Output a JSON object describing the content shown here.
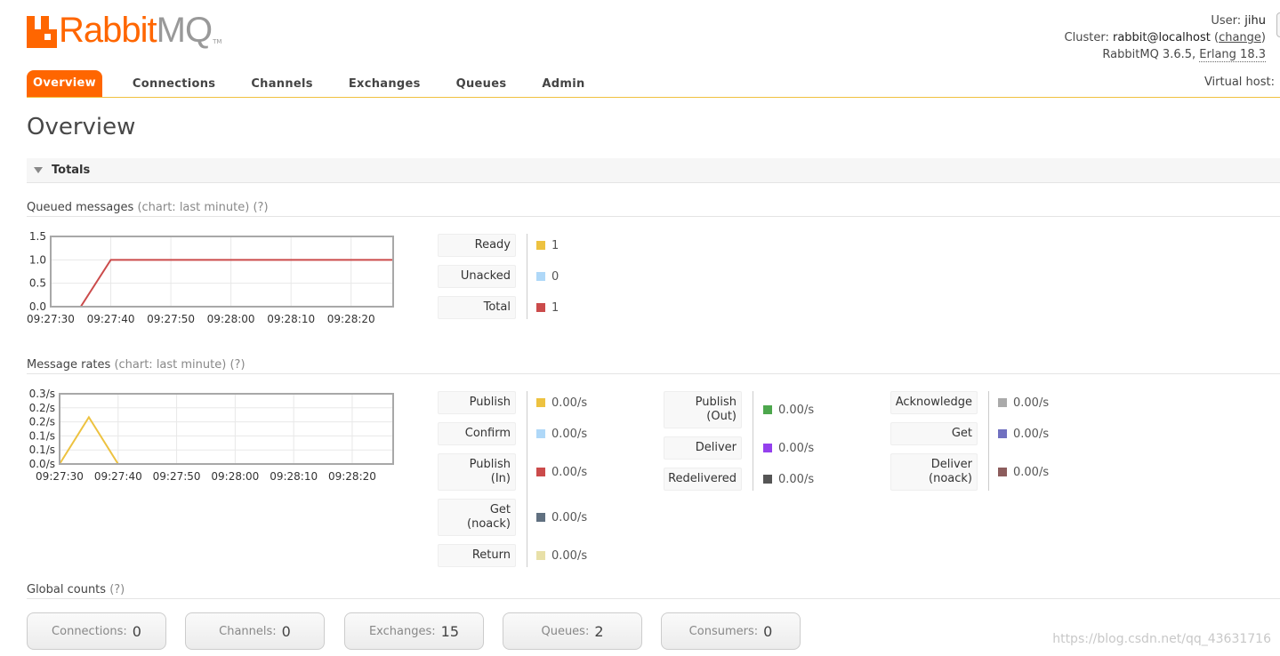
{
  "brand": {
    "word": "Rabbit",
    "word_mq": "MQ",
    "tm": "TM"
  },
  "login": {
    "user_label": "User:",
    "user": "jihu",
    "cluster_label": "Cluster:",
    "cluster": "rabbit@localhost",
    "change_label": "change",
    "version": "RabbitMQ 3.6.5,",
    "erlang": "Erlang 18.3"
  },
  "tabs": [
    "Overview",
    "Connections",
    "Channels",
    "Exchanges",
    "Queues",
    "Admin"
  ],
  "virtual_host_label": "Virtual host:",
  "page_title": "Overview",
  "totals_label": "Totals",
  "queued": {
    "title": "Queued messages",
    "sub": "(chart: last minute)",
    "help": "(?)",
    "legend": [
      {
        "label": "Ready",
        "value": "1",
        "color": "#edc240"
      },
      {
        "label": "Unacked",
        "value": "0",
        "color": "#afd8f8"
      },
      {
        "label": "Total",
        "value": "1",
        "color": "#cb4b4b"
      }
    ]
  },
  "rates": {
    "title": "Message rates",
    "sub": "(chart: last minute)",
    "help": "(?)",
    "col1": [
      {
        "label": "Publish",
        "value": "0.00/s",
        "color": "#edc240"
      },
      {
        "label": "Confirm",
        "value": "0.00/s",
        "color": "#afd8f8"
      },
      {
        "label": "Publish\n(In)",
        "value": "0.00/s",
        "color": "#cb4b4b"
      },
      {
        "label": "Get\n(noack)",
        "value": "0.00/s",
        "color": "#607080"
      },
      {
        "label": "Return",
        "value": "0.00/s",
        "color": "#e8e0a8"
      }
    ],
    "col2": [
      {
        "label": "Publish\n(Out)",
        "value": "0.00/s",
        "color": "#4da74d"
      },
      {
        "label": "Deliver",
        "value": "0.00/s",
        "color": "#9440ed"
      },
      {
        "label": "Redelivered",
        "value": "0.00/s",
        "color": "#555555"
      }
    ],
    "col3": [
      {
        "label": "Acknowledge",
        "value": "0.00/s",
        "color": "#aaaaaa"
      },
      {
        "label": "Get",
        "value": "0.00/s",
        "color": "#7070c0"
      },
      {
        "label": "Deliver\n(noack)",
        "value": "0.00/s",
        "color": "#8c5c5c"
      }
    ]
  },
  "global": {
    "title": "Global counts",
    "help": "(?)",
    "counts": [
      {
        "label": "Connections:",
        "value": "0"
      },
      {
        "label": "Channels:",
        "value": "0"
      },
      {
        "label": "Exchanges:",
        "value": "15"
      },
      {
        "label": "Queues:",
        "value": "2"
      },
      {
        "label": "Consumers:",
        "value": "0"
      }
    ]
  },
  "chart_data": [
    {
      "type": "line",
      "title": "Queued messages",
      "x": [
        "09:27:30",
        "09:27:35",
        "09:27:40",
        "09:27:50",
        "09:28:00",
        "09:28:10",
        "09:28:20",
        "09:28:27"
      ],
      "xticks": [
        "09:27:30",
        "09:27:40",
        "09:27:50",
        "09:28:00",
        "09:28:10",
        "09:28:20"
      ],
      "yticks": [
        "1.5",
        "1.0",
        "0.5",
        "0.0"
      ],
      "ylim": [
        0,
        1.5
      ],
      "series": [
        {
          "name": "Total",
          "color": "#cb4b4b",
          "values": [
            0,
            0,
            1,
            1,
            1,
            1,
            1,
            1
          ]
        },
        {
          "name": "Unacked",
          "color": "#afd8f8",
          "values": [
            0,
            0,
            0,
            0,
            0,
            0,
            0,
            0
          ]
        }
      ],
      "grid": true
    },
    {
      "type": "line",
      "title": "Message rates",
      "x": [
        "09:27:30",
        "09:27:35",
        "09:27:40",
        "09:27:50",
        "09:28:00",
        "09:28:10",
        "09:28:20",
        "09:28:27"
      ],
      "xticks": [
        "09:27:30",
        "09:27:40",
        "09:27:50",
        "09:28:00",
        "09:28:10",
        "09:28:20"
      ],
      "yticks": [
        "0.3/s",
        "0.2/s",
        "0.2/s",
        "0.1/s",
        "0.1/s",
        "0.0/s"
      ],
      "ylim": [
        0,
        0.3
      ],
      "series": [
        {
          "name": "Publish",
          "color": "#edc240",
          "values": [
            0,
            0.2,
            0,
            0,
            0,
            0,
            0,
            0
          ]
        },
        {
          "name": "Publish (Out)",
          "color": "#4da74d",
          "values": [
            0,
            0,
            0,
            0,
            0,
            0,
            0,
            0
          ]
        }
      ],
      "grid": true
    }
  ],
  "watermark": "https://blog.csdn.net/qq_43631716"
}
